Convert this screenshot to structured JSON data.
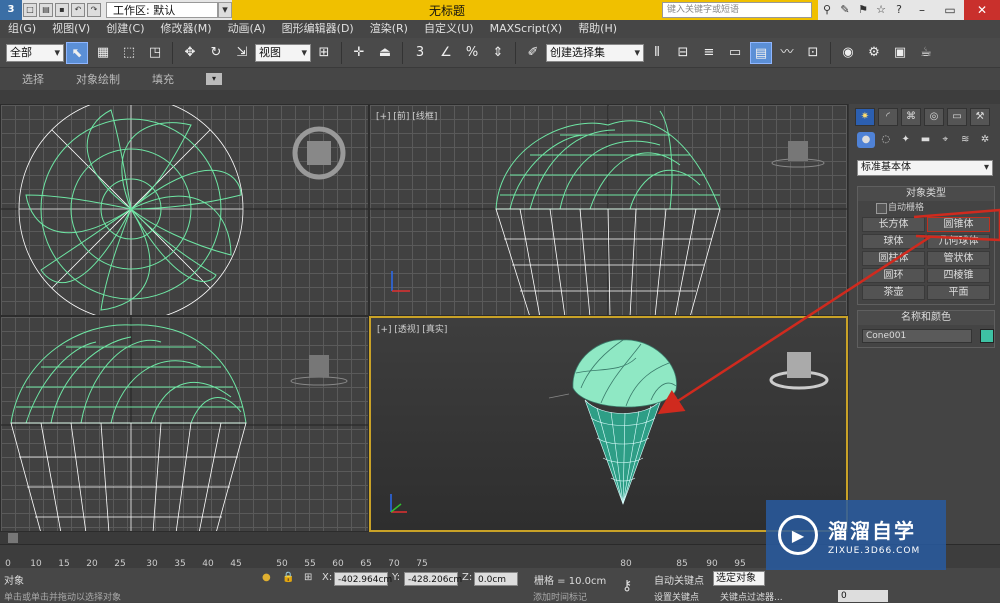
{
  "titlebar": {
    "workspace_label": "工作区: 默认",
    "title": "无标题",
    "search_placeholder": "键入关键字或短语"
  },
  "menu": [
    "组(G)",
    "视图(V)",
    "创建(C)",
    "修改器(M)",
    "动画(A)",
    "图形编辑器(D)",
    "渲染(R)",
    "自定义(U)",
    "MAXScript(X)",
    "帮助(H)"
  ],
  "toolbar": {
    "filter_select": "全部",
    "ref_coord_select": "视图",
    "named_selection_set": "创建选择集",
    "snap_label": "3"
  },
  "ribbon": {
    "tabs": [
      "选择",
      "对象绘制",
      "填充"
    ]
  },
  "viewports": {
    "top_left_label": "",
    "front_label": "[+] [前] [线框]",
    "left_label": "",
    "perspective_label": "[+] [透视] [真实]"
  },
  "command_panel": {
    "category": "标准基本体",
    "object_type_title": "对象类型",
    "autogrid_label": "自动栅格",
    "objects": [
      "长方体",
      "圆锥体",
      "球体",
      "几何球体",
      "圆柱体",
      "管状体",
      "圆环",
      "四棱锥",
      "茶壶",
      "平面"
    ],
    "highlighted_object": "圆锥体",
    "name_color_title": "名称和颜色",
    "object_name": "Cone001",
    "object_color": "#3ec2a4"
  },
  "timeline": {
    "ticks": [
      "0",
      "10",
      "15",
      "20",
      "25",
      "30",
      "35",
      "40",
      "45",
      "50",
      "55",
      "60",
      "65",
      "70",
      "75",
      "80",
      "85",
      "90",
      "95"
    ]
  },
  "status": {
    "selection": "对象",
    "hint": "单击或单击并拖动以选择对象",
    "x_label": "X:",
    "x_value": "-402.964cm",
    "y_label": "Y:",
    "y_value": "-428.206cm",
    "z_label": "Z:",
    "z_value": "0.0cm",
    "grid": "栅格 = 10.0cm",
    "add_time_tag": "添加时间标记",
    "auto_key": "自动关键点",
    "selected_set": "选定对象",
    "set_key": "设置关键点",
    "key_filters": "关键点过滤器...",
    "frame": "0"
  },
  "watermark": {
    "title": "溜溜自学",
    "url": "ZIXUE.3D66.COM"
  },
  "colors": {
    "wireframe": "#6ee6a4",
    "highlight_red": "#d02a1e",
    "active_border": "#c9a227"
  }
}
